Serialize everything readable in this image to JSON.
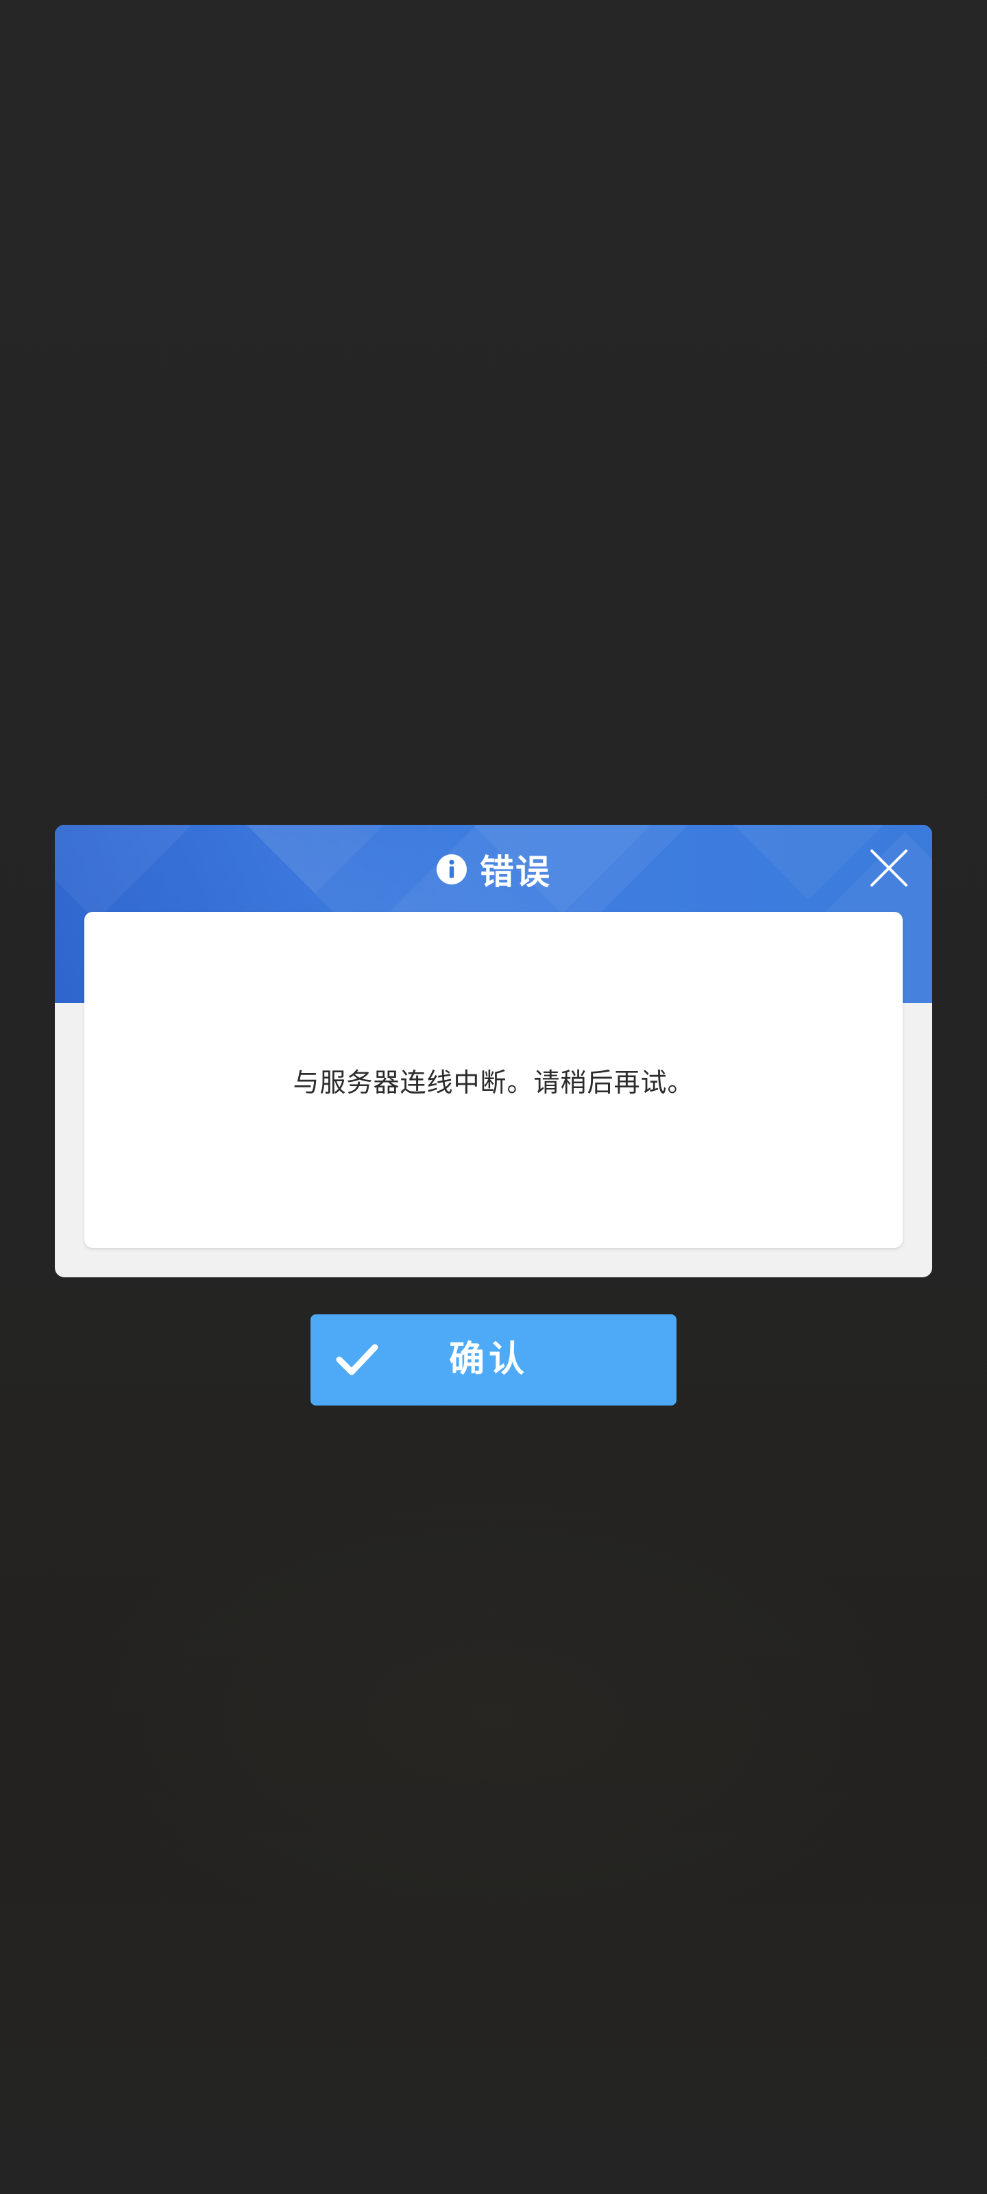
{
  "dialog": {
    "title": "错误",
    "title_icon": "info-icon",
    "close_icon": "close-icon",
    "message": "与服务器连线中断。请稍后再试。"
  },
  "actions": {
    "confirm_label": "确认",
    "confirm_icon": "checkmark-icon"
  },
  "colors": {
    "header_blue": "#3a78dc",
    "confirm_blue": "#4eaaf6",
    "backdrop": "#252525",
    "dialog_frame": "#f1f1f1"
  }
}
